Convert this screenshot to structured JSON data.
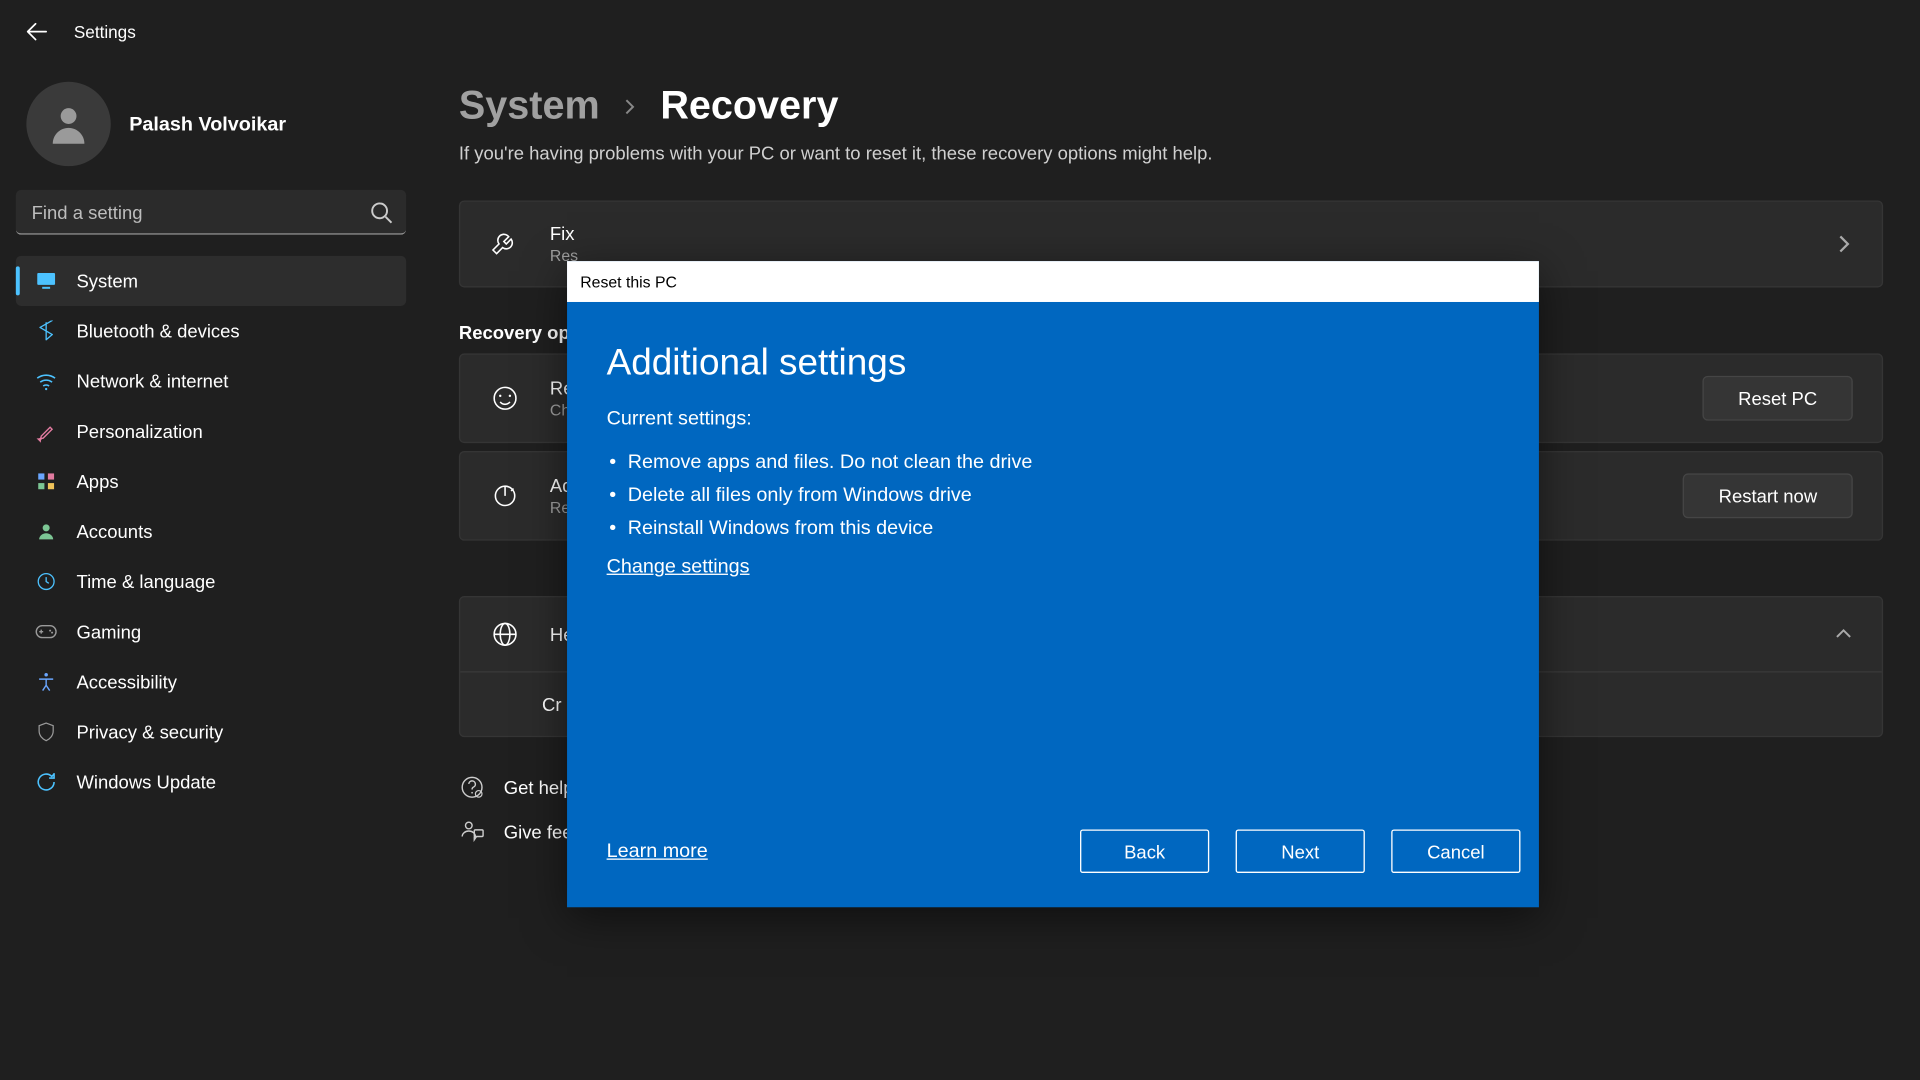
{
  "app": {
    "title": "Settings"
  },
  "user": {
    "name": "Palash Volvoikar"
  },
  "search": {
    "placeholder": "Find a setting"
  },
  "nav": {
    "items": [
      {
        "label": "System",
        "icon": "monitor",
        "color": "#4cc2ff",
        "selected": true
      },
      {
        "label": "Bluetooth & devices",
        "icon": "bluetooth",
        "color": "#4cc2ff",
        "selected": false
      },
      {
        "label": "Network & internet",
        "icon": "wifi",
        "color": "#4cc2ff",
        "selected": false
      },
      {
        "label": "Personalization",
        "icon": "brush",
        "color": "#e27ba0",
        "selected": false
      },
      {
        "label": "Apps",
        "icon": "grid",
        "color": "#9a9a9a",
        "selected": false
      },
      {
        "label": "Accounts",
        "icon": "person",
        "color": "#7cc694",
        "selected": false
      },
      {
        "label": "Time & language",
        "icon": "clock",
        "color": "#4cc2ff",
        "selected": false
      },
      {
        "label": "Gaming",
        "icon": "gamepad",
        "color": "#9a9a9a",
        "selected": false
      },
      {
        "label": "Accessibility",
        "icon": "access",
        "color": "#6aa6ff",
        "selected": false
      },
      {
        "label": "Privacy & security",
        "icon": "shield",
        "color": "#9a9a9a",
        "selected": false
      },
      {
        "label": "Windows Update",
        "icon": "update",
        "color": "#4cc2ff",
        "selected": false
      }
    ]
  },
  "breadcrumb": {
    "parent": "System",
    "current": "Recovery"
  },
  "intro": "If you're having problems with your PC or want to reset it, these recovery options might help.",
  "cards": {
    "fix": {
      "title": "Fix",
      "desc": "Res"
    },
    "section_label": "Recovery op",
    "reset": {
      "title": "Re",
      "desc": "Ch",
      "button": "Reset PC"
    },
    "advanced": {
      "title": "Ad",
      "desc": "Res",
      "button": "Restart now"
    },
    "help_expander": {
      "title": "He",
      "body": "Cr"
    }
  },
  "help_links": {
    "get_help": "Get help",
    "give_feedback": "Give feedback"
  },
  "dialog": {
    "window_title": "Reset this PC",
    "heading": "Additional settings",
    "current_label": "Current settings:",
    "bullets": [
      "Remove apps and files. Do not clean the drive",
      "Delete all files only from Windows drive",
      "Reinstall Windows from this device"
    ],
    "change_link": "Change settings",
    "learn_more": "Learn more",
    "buttons": {
      "back": "Back",
      "next": "Next",
      "cancel": "Cancel"
    }
  }
}
